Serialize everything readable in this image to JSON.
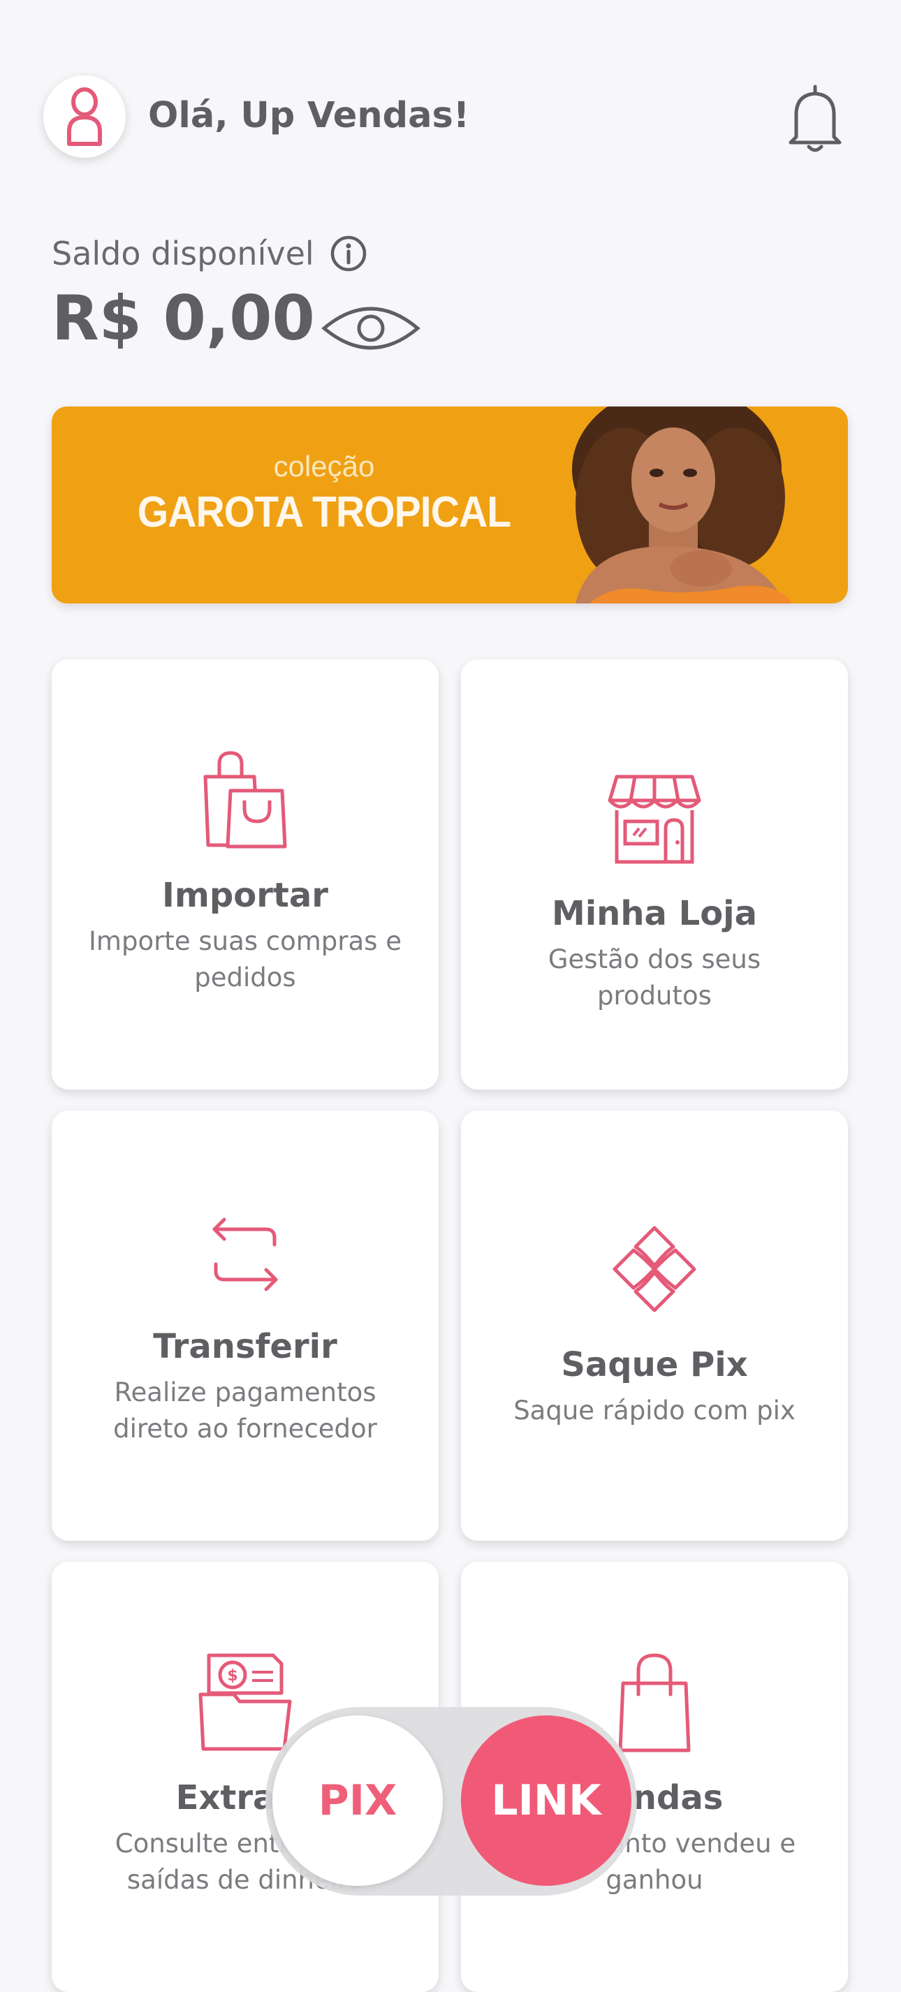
{
  "header": {
    "greeting": "Olá, Up Vendas!",
    "avatar_icon": "user-icon",
    "notification_icon": "bell-icon"
  },
  "balance": {
    "label": "Saldo disponível",
    "value": "R$ 0,00",
    "info_icon": "info-icon",
    "visibility_icon": "eye-icon"
  },
  "banner": {
    "subtitle": "coleção",
    "title": "GAROTA TROPICAL"
  },
  "cards": [
    {
      "title": "Importar",
      "description": "Importe suas compras e pedidos",
      "icon": "shopping-bags-icon"
    },
    {
      "title": "Minha Loja",
      "description": "Gestão dos seus produtos",
      "icon": "store-icon"
    },
    {
      "title": "Transferir",
      "description": "Realize pagamentos direto ao fornecedor",
      "icon": "transfer-arrows-icon"
    },
    {
      "title": "Saque Pix",
      "description": "Saque rápido com pix",
      "icon": "pix-icon"
    },
    {
      "title": "Extrato",
      "description": "Consulte entradas e saídas de dinheiro",
      "icon": "statement-icon"
    },
    {
      "title": "Vendas",
      "description": "Veja quanto vendeu e ganhou",
      "icon": "shopping-bag-icon"
    }
  ],
  "toggle": {
    "pix_label": "PIX",
    "link_label": "LINK"
  },
  "colors": {
    "accent": "#f05a77",
    "icon_pink": "#e45a78",
    "banner_bg": "#efa113",
    "background": "#f7f6f9"
  }
}
